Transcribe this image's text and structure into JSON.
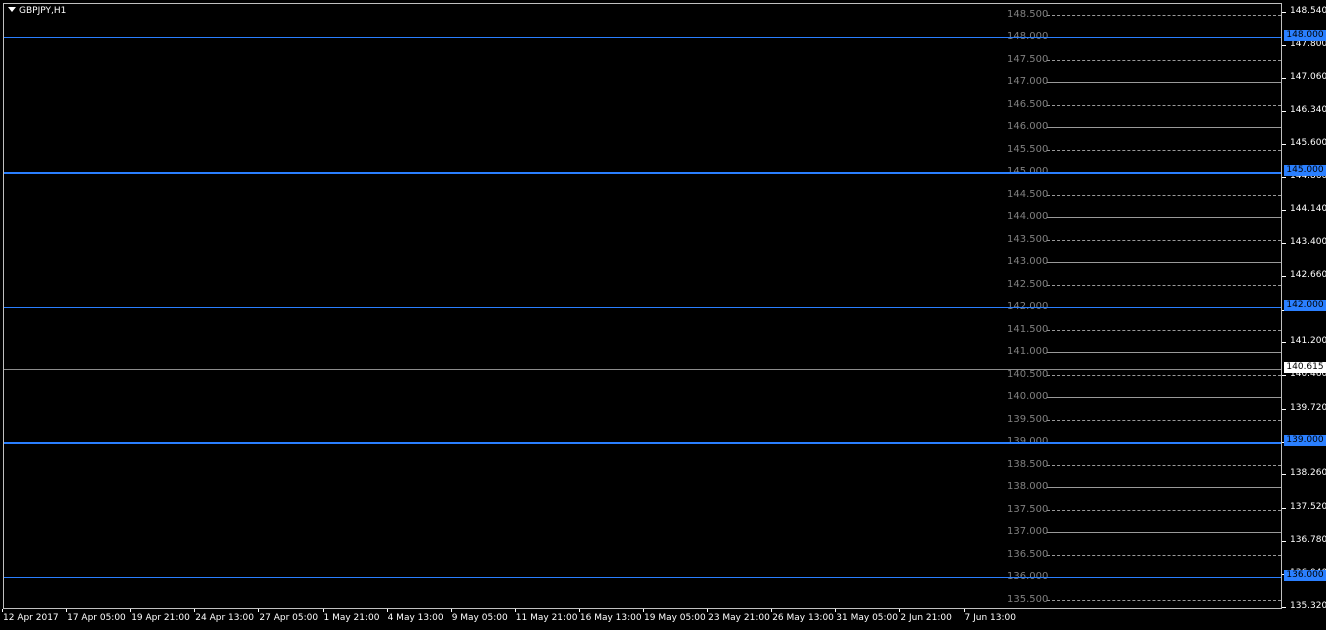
{
  "window": {
    "title": "GBPJPY,H1"
  },
  "colors": {
    "blue_line": "#2a7fff",
    "current_line": "#8c8c8c",
    "level_solid": "#9a9a9a",
    "level_dash": "#9a9a9a",
    "bg": "#000000"
  },
  "horizontal_lines": [
    {
      "price": "148.000",
      "kind": "blue"
    },
    {
      "price": "145.000",
      "kind": "blue"
    },
    {
      "price": "142.000",
      "kind": "blue"
    },
    {
      "price": "140.615",
      "kind": "current"
    },
    {
      "price": "139.000",
      "kind": "blue"
    },
    {
      "price": "136.000",
      "kind": "blue"
    }
  ],
  "level_labels": [
    "148.500",
    "148.000",
    "147.500",
    "147.000",
    "146.500",
    "146.000",
    "145.500",
    "145.000",
    "144.500",
    "144.000",
    "143.500",
    "143.000",
    "142.500",
    "142.000",
    "141.500",
    "141.000",
    "140.500",
    "140.000",
    "139.500",
    "139.000",
    "138.500",
    "138.000",
    "137.500",
    "137.000",
    "136.500",
    "136.000",
    "135.500"
  ],
  "price_axis_ticks": [
    "148.540",
    "147.800",
    "147.060",
    "146.340",
    "145.600",
    "144.860",
    "144.140",
    "143.400",
    "142.660",
    "141.920",
    "141.200",
    "140.460",
    "139.720",
    "138.980",
    "138.260",
    "137.520",
    "136.780",
    "136.040",
    "135.320"
  ],
  "time_axis_ticks": [
    "12 Apr 2017",
    "17 Apr 05:00",
    "19 Apr 21:00",
    "24 Apr 13:00",
    "27 Apr 05:00",
    "1 May 21:00",
    "4 May 13:00",
    "9 May 05:00",
    "11 May 21:00",
    "16 May 13:00",
    "19 May 05:00",
    "23 May 21:00",
    "26 May 13:00",
    "31 May 05:00",
    "2 Jun 21:00",
    "7 Jun 13:00"
  ]
}
